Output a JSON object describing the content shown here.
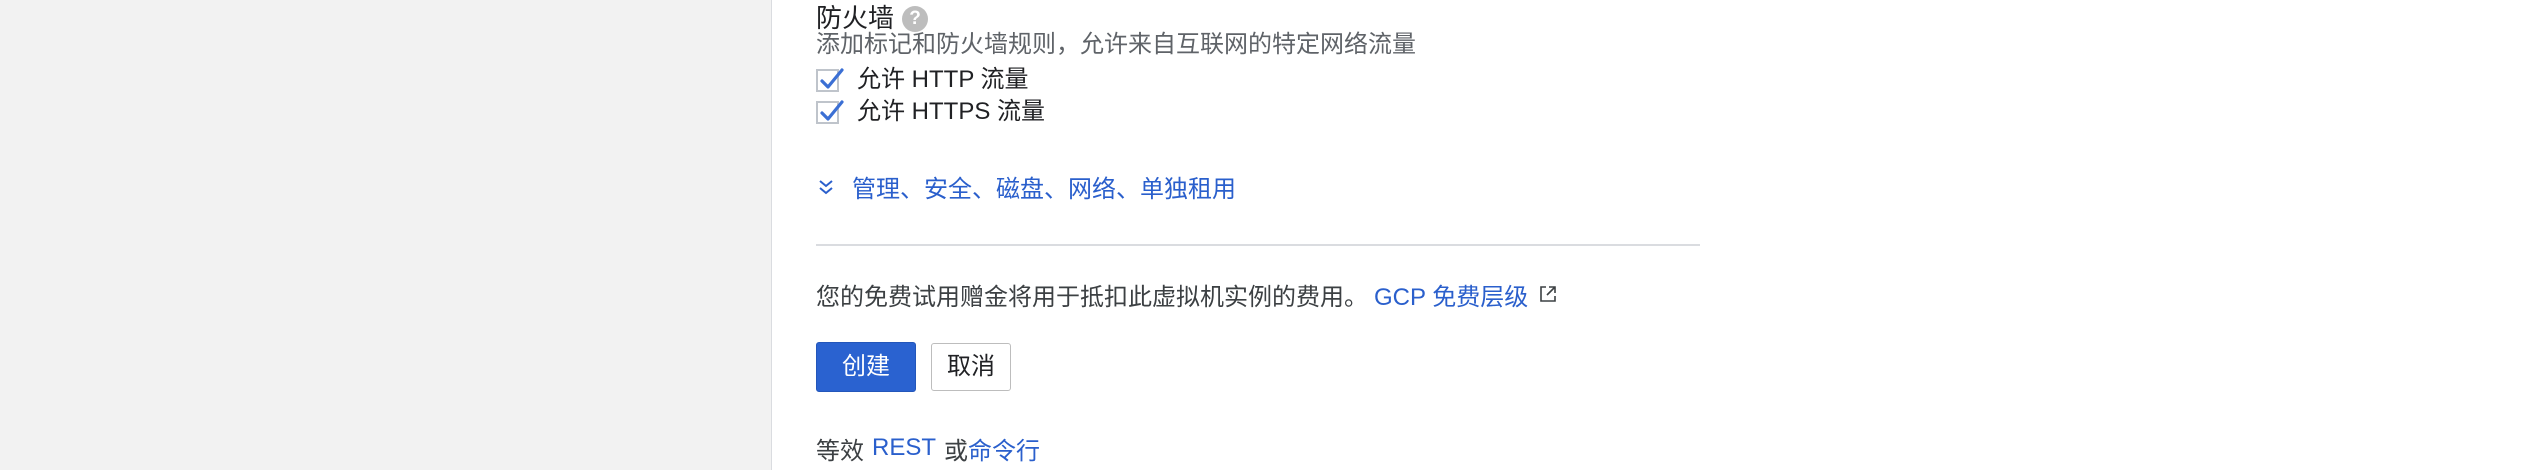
{
  "firewall": {
    "title": "防火墙",
    "help_icon": "help-circle-icon",
    "description": "添加标记和防火墙规则，允许来自互联网的特定网络流量",
    "http_label": "允许 HTTP 流量",
    "http_checked": true,
    "https_label": "允许 HTTPS 流量",
    "https_checked": true
  },
  "advanced": {
    "expand_label": "管理、安全、磁盘、网络、单独租用",
    "icon": "chevron-double-down-icon"
  },
  "free_trial": {
    "note": "您的免费试用赠金将用于抵扣此虚拟机实例的费用。",
    "link": "GCP 免费层级",
    "link_icon": "external-link-icon"
  },
  "actions": {
    "create_label": "创建",
    "cancel_label": "取消"
  },
  "equivalent": {
    "prefix": "等效",
    "rest_link": "REST",
    "or_text": "或",
    "cli_link": "命令行"
  },
  "colors": {
    "link": "#2a5fcc",
    "primary_button": "#2a62d0",
    "checkbox_check": "#3b6fd4",
    "side_panel": "#f2f2f2"
  }
}
